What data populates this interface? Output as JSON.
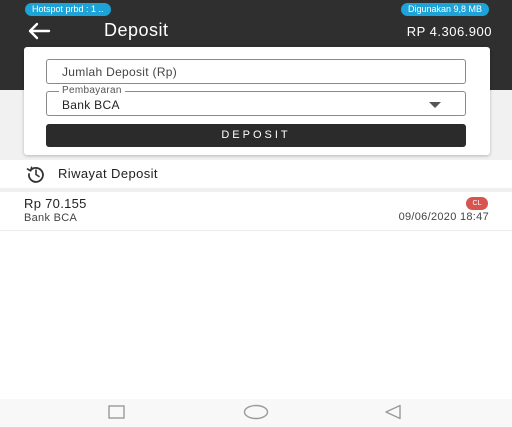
{
  "status_bar": {
    "hotspot": "Hotspot prbd : 1 ..",
    "data_used": "Digunakan 9,8 MB"
  },
  "app_bar": {
    "title": "Deposit",
    "balance": "RP 4.306.900"
  },
  "form": {
    "amount_placeholder": "Jumlah Deposit (Rp)",
    "payment_label": "Pembayaran",
    "payment_value": "Bank BCA",
    "submit_label": "DEPOSIT"
  },
  "history": {
    "title": "Riwayat Deposit",
    "items": [
      {
        "amount": "Rp 70.155",
        "method": "Bank BCA",
        "status": "CL",
        "date": "09/06/2020 18:47"
      }
    ]
  },
  "colors": {
    "app_bar": "#2f2f2f",
    "status_pill": "#1ea3d8",
    "status_badge": "#d9534f"
  },
  "icons": {
    "back": "arrow-left-icon",
    "dropdown": "caret-down-icon",
    "history": "history-icon",
    "nav": [
      "recent-apps-icon",
      "home-icon",
      "back-triangle-icon"
    ]
  }
}
